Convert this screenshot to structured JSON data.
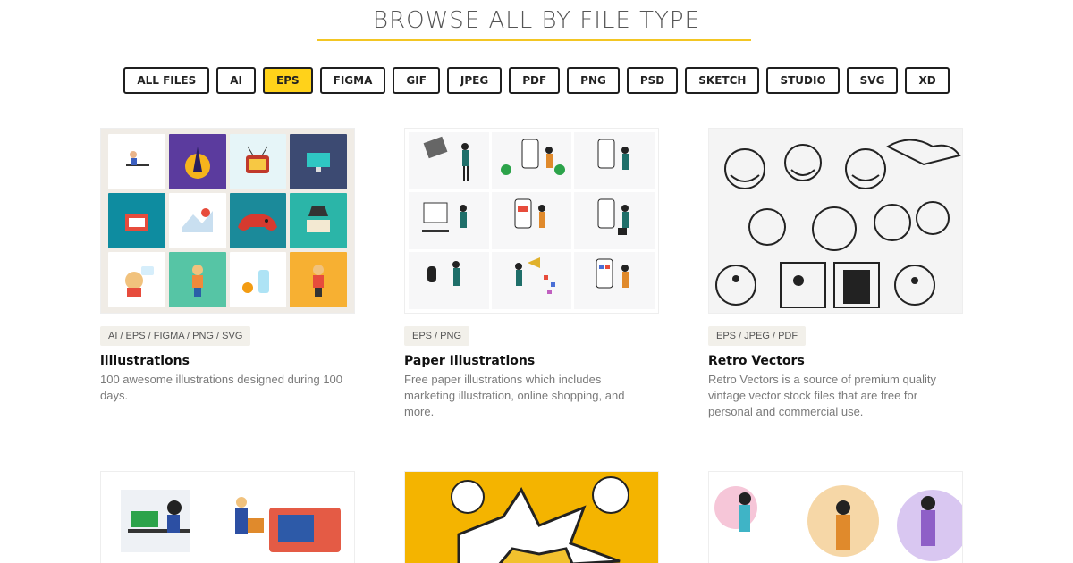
{
  "header": {
    "title": "BROWSE ALL BY FILE TYPE"
  },
  "filters": [
    {
      "label": "ALL FILES",
      "active": false
    },
    {
      "label": "AI",
      "active": false
    },
    {
      "label": "EPS",
      "active": true
    },
    {
      "label": "FIGMA",
      "active": false
    },
    {
      "label": "GIF",
      "active": false
    },
    {
      "label": "JPEG",
      "active": false
    },
    {
      "label": "PDF",
      "active": false
    },
    {
      "label": "PNG",
      "active": false
    },
    {
      "label": "PSD",
      "active": false
    },
    {
      "label": "SKETCH",
      "active": false
    },
    {
      "label": "STUDIO",
      "active": false
    },
    {
      "label": "SVG",
      "active": false
    },
    {
      "label": "XD",
      "active": false
    }
  ],
  "cards": [
    {
      "tags": "AI / EPS / FIGMA / PNG / SVG",
      "name": "illlustrations",
      "description": "100 awesome illustrations designed during 100 days."
    },
    {
      "tags": "EPS / PNG",
      "name": "Paper Illustrations",
      "description": "Free paper illustrations which includes marketing illustration, online shopping, and more."
    },
    {
      "tags": "EPS / JPEG / PDF",
      "name": "Retro Vectors",
      "description": "Retro Vectors is a source of premium quality vintage vector stock files that are free for personal and commercial use."
    }
  ],
  "colors": {
    "accent": "#ffd21a",
    "underline": "#f3c623",
    "comic_bg": "#f4b400"
  }
}
